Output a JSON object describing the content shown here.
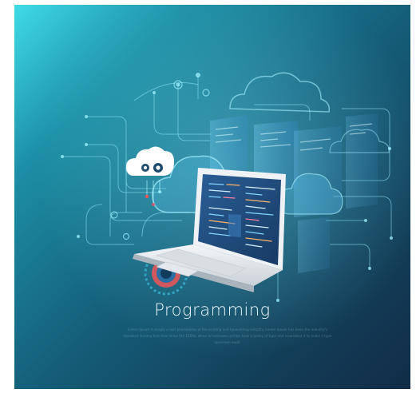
{
  "title": "Programming",
  "body_text": "Lorem Ipsum is simply a text placeholder of the printing and typesetting industry. Lorem Ipsum has been the industry's standard dummy text ever since the 1500s, when an unknown printer took a galley of type and scrambled it to make a type specimen book.",
  "colors": {
    "gradient_light": "#3fdbe7",
    "gradient_dark": "#112c47",
    "circuit_line": "#8fe6f5",
    "accent_red": "#e2575a",
    "cloud_white": "#ffffff"
  },
  "icons": [
    "laptop-icon",
    "cloud-icon",
    "eye-icon",
    "gear-icon",
    "circuit-lines",
    "code-window"
  ]
}
